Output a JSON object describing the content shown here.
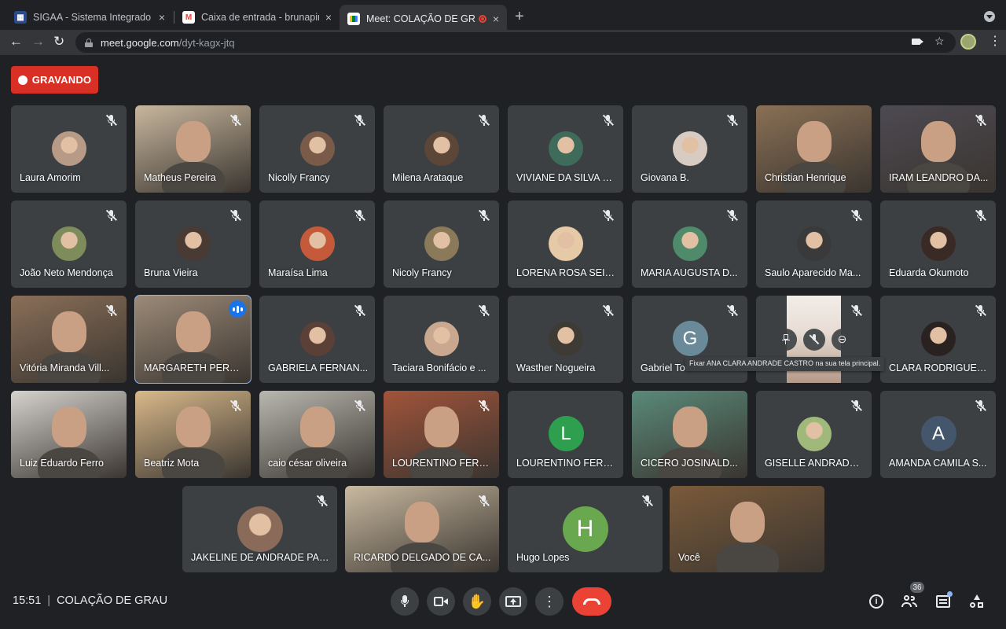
{
  "browser": {
    "tabs": [
      {
        "title": "SIGAA - Sistema Integrado de",
        "icon": "sigaa-icon",
        "close": "×"
      },
      {
        "title": "Caixa de entrada - brunapinotti",
        "icon": "gmail-icon",
        "close": "×"
      },
      {
        "title": "Meet: COLAÇÃO DE GRAU",
        "icon": "meet-icon",
        "close": "×"
      }
    ],
    "new_tab": "+",
    "url_host": "meet.google.com",
    "url_path": "/dyt-kagx-jtq"
  },
  "meet": {
    "recording_label": "GRAVANDO",
    "tooltip": "Fixar ANA CLARA ANDRADE CASTRO na sua tela principal.",
    "participants": [
      {
        "name": "Laura Amorim",
        "kind": "avatar",
        "muted": true,
        "color": "#b89b86"
      },
      {
        "name": "Matheus Pereira",
        "kind": "video",
        "muted": true,
        "color": "#c8b79e"
      },
      {
        "name": "Nicolly Francy",
        "kind": "avatar",
        "muted": true,
        "color": "#7a5a48"
      },
      {
        "name": "Milena Arataque",
        "kind": "avatar",
        "muted": true,
        "color": "#5c4638"
      },
      {
        "name": "VIVIANE DA SILVA PI...",
        "kind": "avatar",
        "muted": true,
        "color": "#3e6b5a"
      },
      {
        "name": "Giovana B.",
        "kind": "avatar",
        "muted": true,
        "color": "#d8cbc2"
      },
      {
        "name": "Christian Henrique",
        "kind": "video",
        "muted": false,
        "color": "#8a7055"
      },
      {
        "name": "IRAM LEANDRO DA...",
        "kind": "video",
        "muted": true,
        "color": "#4d4a52"
      },
      {
        "name": "João Neto Mendonça",
        "kind": "avatar",
        "muted": true,
        "color": "#7d8c5a"
      },
      {
        "name": "Bruna Vieira",
        "kind": "avatar",
        "muted": true,
        "color": "#4a3a34"
      },
      {
        "name": "Maraísa Lima",
        "kind": "avatar",
        "muted": true,
        "color": "#c45a3a"
      },
      {
        "name": "Nicoly Francy",
        "kind": "avatar",
        "muted": true,
        "color": "#8a7a5a"
      },
      {
        "name": "LORENA ROSA SEIX...",
        "kind": "avatar",
        "muted": true,
        "color": "#e6c9a6"
      },
      {
        "name": "MARIA AUGUSTA D...",
        "kind": "avatar",
        "muted": true,
        "color": "#4f8a6a"
      },
      {
        "name": "Saulo Aparecido Ma...",
        "kind": "avatar",
        "muted": true,
        "color": "#3a3a3a"
      },
      {
        "name": "Eduarda Okumoto",
        "kind": "avatar",
        "muted": true,
        "color": "#3a2a26"
      },
      {
        "name": "Vitória Miranda Vill...",
        "kind": "video",
        "muted": true,
        "color": "#8a6f58"
      },
      {
        "name": "MARGARETH PEREI...",
        "kind": "video",
        "muted": false,
        "speaking": true,
        "color": "#9c8a78"
      },
      {
        "name": "GABRIELA FERNAN...",
        "kind": "avatar",
        "muted": true,
        "color": "#5a4036"
      },
      {
        "name": "Taciara Bonifácio e ...",
        "kind": "avatar",
        "muted": true,
        "color": "#caa890"
      },
      {
        "name": "Wasther Nogueira",
        "kind": "avatar",
        "muted": true,
        "color": "#3e3a36"
      },
      {
        "name": "Gabriel To",
        "kind": "letter",
        "letter": "G",
        "muted": true,
        "color": "#6b8a99"
      },
      {
        "name": "",
        "kind": "hover",
        "muted": true,
        "color": "#e8ddd5"
      },
      {
        "name": "CLARA RODRIGUES...",
        "kind": "avatar",
        "muted": true,
        "color": "#2a2220"
      },
      {
        "name": "Luiz Eduardo Ferro",
        "kind": "video",
        "muted": false,
        "color": "#d6d3cf"
      },
      {
        "name": "Beatriz Mota",
        "kind": "video",
        "muted": true,
        "color": "#d9b98a"
      },
      {
        "name": "caio césar oliveira",
        "kind": "video",
        "muted": true,
        "color": "#b9b8b0"
      },
      {
        "name": "LOURENTINO FERR...",
        "kind": "video",
        "muted": true,
        "color": "#a2543a"
      },
      {
        "name": "LOURENTINO FERR...",
        "kind": "letter",
        "letter": "L",
        "muted": false,
        "color": "#2e9e4f"
      },
      {
        "name": "CICERO JOSINALD...",
        "kind": "video",
        "muted": false,
        "color": "#5a8a7a"
      },
      {
        "name": "GISELLE ANDRADE ...",
        "kind": "avatar",
        "muted": true,
        "color": "#a0b87a"
      },
      {
        "name": "AMANDA CAMILA S...",
        "kind": "letter",
        "letter": "A",
        "muted": true,
        "color": "#44566b"
      },
      {
        "name": "JAKELINE DE ANDRADE PAC...",
        "kind": "avatar",
        "muted": true,
        "color": "#8a6a58"
      },
      {
        "name": "RICARDO DELGADO DE CA...",
        "kind": "video",
        "muted": true,
        "color": "#c8b9a0"
      },
      {
        "name": "Hugo Lopes",
        "kind": "letter",
        "letter": "H",
        "muted": true,
        "color": "#6aa84f"
      },
      {
        "name": "Você",
        "kind": "video",
        "muted": false,
        "color": "#7a5a3a"
      }
    ],
    "time": "15:51",
    "meeting_title": "COLAÇÃO DE GRAU",
    "people_count": "36",
    "controls": [
      "mic-icon",
      "camera-icon",
      "raise-hand-icon",
      "present-icon",
      "more-icon",
      "end-call-icon"
    ],
    "right_controls": [
      "info-icon",
      "people-icon",
      "chat-icon",
      "activities-icon"
    ]
  }
}
